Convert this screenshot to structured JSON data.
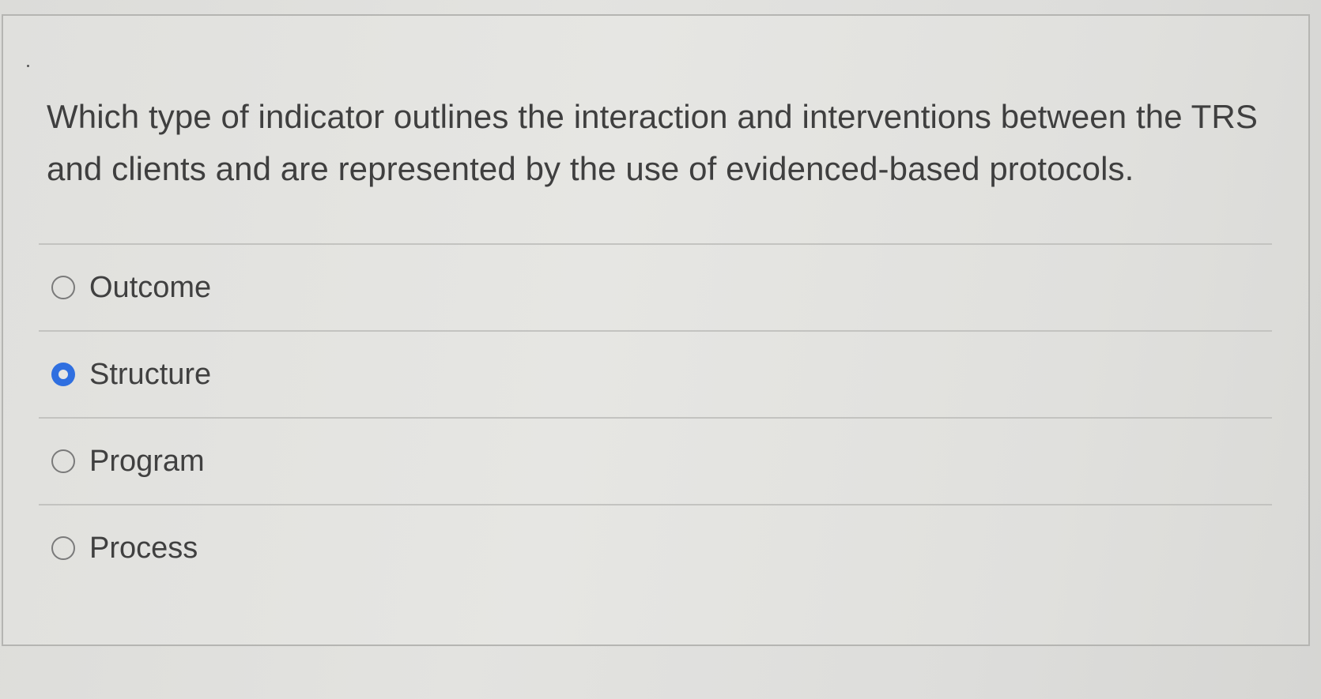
{
  "question": {
    "text": "Which type of indicator outlines the interaction and interventions between the TRS and clients and are represented by the use of evidenced-based protocols."
  },
  "options": [
    {
      "label": "Outcome",
      "selected": false
    },
    {
      "label": "Structure",
      "selected": true
    },
    {
      "label": "Program",
      "selected": false
    },
    {
      "label": "Process",
      "selected": false
    }
  ],
  "colors": {
    "selected_radio": "#2f6fe0",
    "text": "#404040",
    "divider": "#c3c3c0"
  }
}
